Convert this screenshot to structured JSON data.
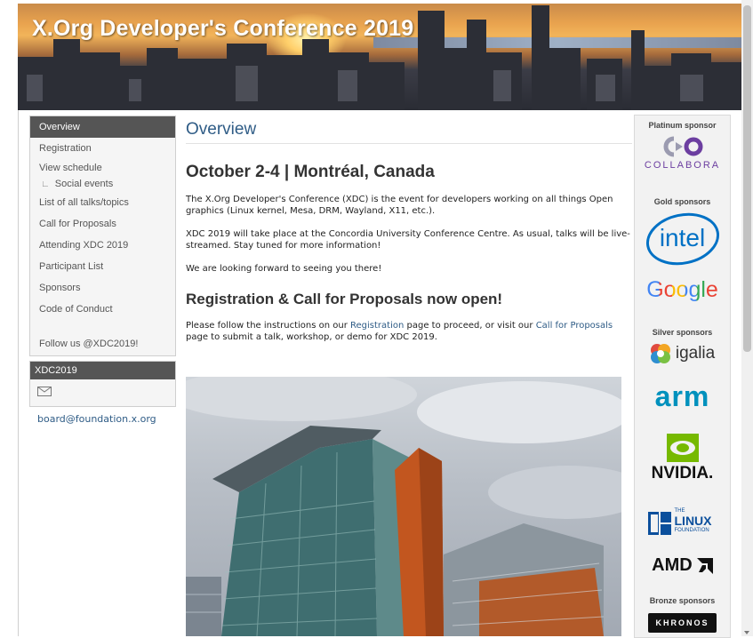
{
  "header": {
    "title": "X.Org Developer's Conference 2019"
  },
  "sidebar": {
    "items": [
      {
        "label": "Overview"
      },
      {
        "label": "Registration"
      },
      {
        "label": "View schedule"
      },
      {
        "label": "Social events"
      },
      {
        "label": "List of all talks/topics"
      },
      {
        "label": "Call for Proposals"
      },
      {
        "label": "Attending XDC 2019"
      },
      {
        "label": "Participant List"
      },
      {
        "label": "Sponsors"
      },
      {
        "label": "Code of Conduct"
      }
    ],
    "follow": "Follow us @XDC2019!",
    "contact": {
      "heading": "XDC2019",
      "email": "board@foundation.x.org"
    }
  },
  "main": {
    "page_title": "Overview",
    "date_heading": "October 2-4 | Montréal, Canada",
    "intro": "The X.Org Developer's Conference (XDC) is the event for developers working on all things Open graphics (Linux kernel, Mesa, DRM, Wayland, X11, etc.).",
    "venue": "XDC 2019 will take place at the Concordia University Conference Centre. As usual, talks will be live-streamed. Stay tuned for more information!",
    "looking_forward": "We are looking forward to seeing you there!",
    "registration_heading": "Registration & Call for Proposals now open!",
    "registration": {
      "before": "Please follow the instructions on our ",
      "link1": "Registration",
      "middle": " page to proceed, or visit our ",
      "link2": "Call for Proposals",
      "after": " page to submit a talk, workshop, or demo for XDC 2019."
    }
  },
  "sponsors": {
    "platinum_label": "Platinum sponsor",
    "gold_label": "Gold sponsors",
    "silver_label": "Silver sponsors",
    "bronze_label": "Bronze sponsors",
    "logos": {
      "collabora": "COLLABORA",
      "intel": "intel",
      "google": "Google",
      "igalia": "igalia",
      "arm": "arm",
      "nvidia": "NVIDIA.",
      "linux_the": "THE",
      "linux_word": "LINUX",
      "linux_foundation": "FOUNDATION",
      "amd": "AMD",
      "khronos": "KHRONOS"
    }
  },
  "colors": {
    "accent": "#2f5c86",
    "nav_active_bg": "#555555",
    "google_blue": "#4285f4",
    "google_red": "#ea4335",
    "google_yellow": "#fbbc05",
    "google_green": "#34a853",
    "intel_blue": "#0071c5",
    "arm_blue": "#0091bd",
    "nvidia_green": "#76b900",
    "linux_blue": "#0b4f9c",
    "collabora_purple": "#6c3ea0"
  }
}
